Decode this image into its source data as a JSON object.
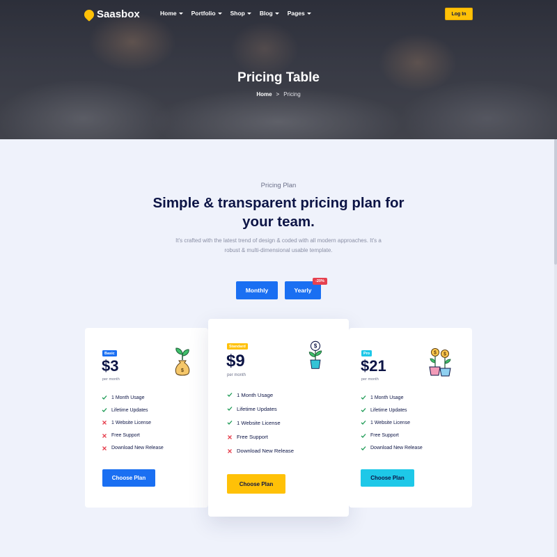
{
  "brand": {
    "name": "Saasbox",
    "accent": "#ffc107"
  },
  "nav": {
    "items": [
      "Home",
      "Portfolio",
      "Shop",
      "Blog",
      "Pages"
    ],
    "login_label": "Log In"
  },
  "hero": {
    "title": "Pricing Table",
    "breadcrumb": {
      "home": "Home",
      "separator": ">",
      "current": "Pricing"
    }
  },
  "intro": {
    "eyebrow": "Pricing Plan",
    "title": "Simple & transparent pricing plan for your team.",
    "description": "It's crafted with the latest trend of design & coded with all modern approaches. It's a robust & multi-dimensional usable template."
  },
  "billing_toggle": {
    "monthly": "Monthly",
    "yearly": "Yearly",
    "discount": "-20%",
    "selected": "Monthly"
  },
  "plans": [
    {
      "badge": "Basic",
      "badge_color": "#1a6ff2",
      "price": "$3",
      "period": "per month",
      "icon": "money-bag-plant-icon",
      "features": [
        {
          "label": "1 Month Usage",
          "included": true
        },
        {
          "label": "Lifetime Updates",
          "included": true
        },
        {
          "label": "1 Website License",
          "included": false
        },
        {
          "label": "Free Support",
          "included": false
        },
        {
          "label": "Download New Release",
          "included": false
        }
      ],
      "cta": "Choose Plan",
      "cta_color": "#1a6ff2"
    },
    {
      "badge": "Standard",
      "badge_color": "#ffc107",
      "price": "$9",
      "period": "per month",
      "icon": "dollar-plant-pot-icon",
      "features": [
        {
          "label": "1 Month Usage",
          "included": true
        },
        {
          "label": "Lifetime Updates",
          "included": true
        },
        {
          "label": "1 Website License",
          "included": true
        },
        {
          "label": "Free Support",
          "included": false
        },
        {
          "label": "Download New Release",
          "included": false
        }
      ],
      "cta": "Choose Plan",
      "cta_color": "#ffc107"
    },
    {
      "badge": "Pro",
      "badge_color": "#1ec8e8",
      "price": "$21",
      "period": "per month",
      "icon": "double-coin-plant-icon",
      "features": [
        {
          "label": "1 Month Usage",
          "included": true
        },
        {
          "label": "Lifetime Updates",
          "included": true
        },
        {
          "label": "1 Website License",
          "included": true
        },
        {
          "label": "Free Support",
          "included": true
        },
        {
          "label": "Download New Release",
          "included": true
        }
      ],
      "cta": "Choose Plan",
      "cta_color": "#1ec8e8"
    }
  ],
  "colors": {
    "check": "#1c9a54",
    "cross": "#e6414f",
    "heading": "#0c1445",
    "background": "#eff2fb"
  }
}
